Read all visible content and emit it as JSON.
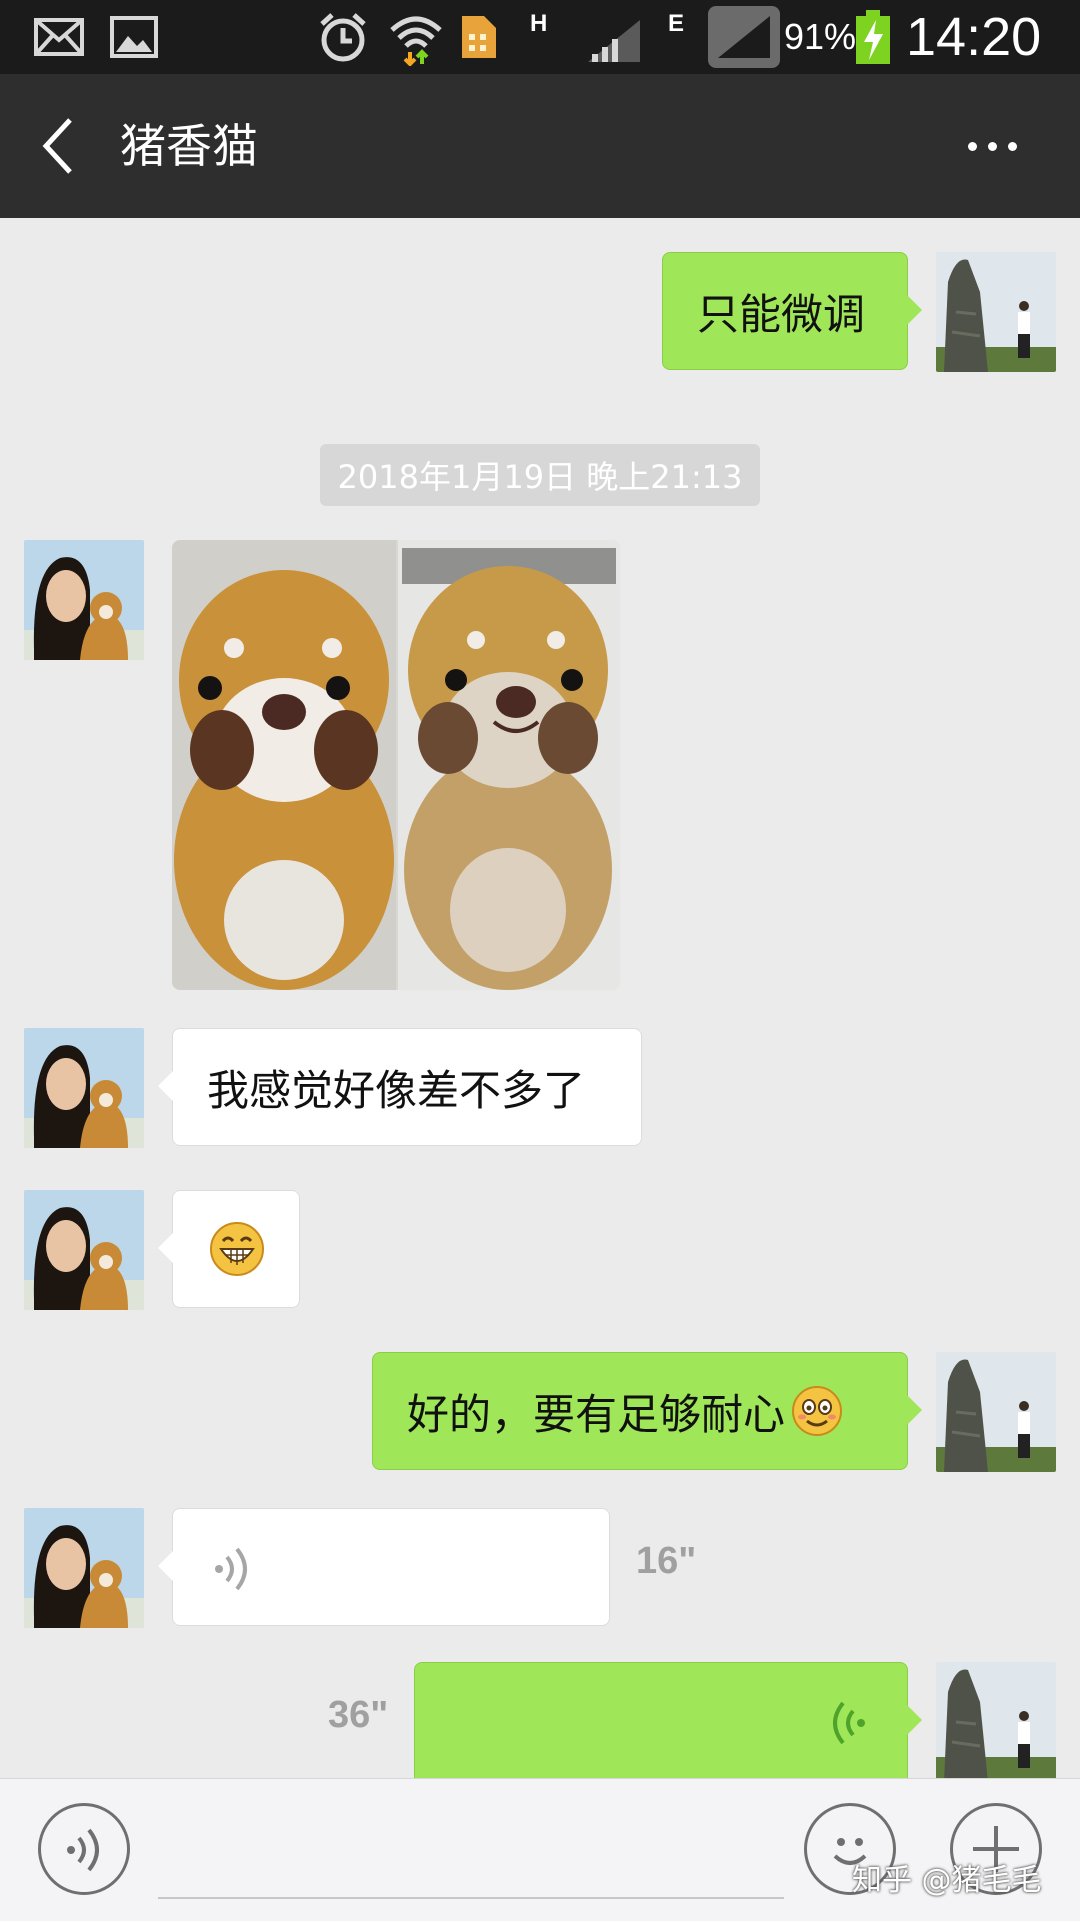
{
  "status_bar": {
    "network_h": "H",
    "network_e": "E",
    "battery": "91%",
    "time": "14:20",
    "icons": [
      "mail-icon",
      "image-icon",
      "alarm-icon",
      "wifi-icon",
      "building-app-icon",
      "signal-icon",
      "battery-charging-icon"
    ]
  },
  "header": {
    "title": "猪香猫",
    "back_icon": "chevron-left-icon",
    "more_icon": "more-dots-icon"
  },
  "messages": [
    {
      "side": "right",
      "type": "text",
      "text": "只能微调"
    },
    {
      "type": "timestamp",
      "text": "2018年1月19日 晚上21:13"
    },
    {
      "side": "left",
      "type": "image",
      "description_icon": "plush-photo"
    },
    {
      "side": "left",
      "type": "text",
      "text": "我感觉好像差不多了"
    },
    {
      "side": "left",
      "type": "emoji",
      "emoji": "grin-emoji"
    },
    {
      "side": "right",
      "type": "text",
      "text": "好的，要有足够耐心"
    },
    {
      "side": "left",
      "type": "voice",
      "duration": "16\""
    },
    {
      "side": "right",
      "type": "voice",
      "duration": "36\""
    }
  ],
  "input_bar": {
    "voice_icon": "voice-toggle-icon",
    "emoji_icon": "emoji-icon",
    "plus_icon": "plus-icon"
  },
  "watermark": "知乎 @猪毛毛",
  "colors": {
    "status_bg": "#1b1b1b",
    "header_bg": "#2e2e2e",
    "chat_bg": "#ebebeb",
    "sent_bubble": "#9fe658",
    "received_bubble": "#ffffff",
    "battery": "#7ed321"
  }
}
